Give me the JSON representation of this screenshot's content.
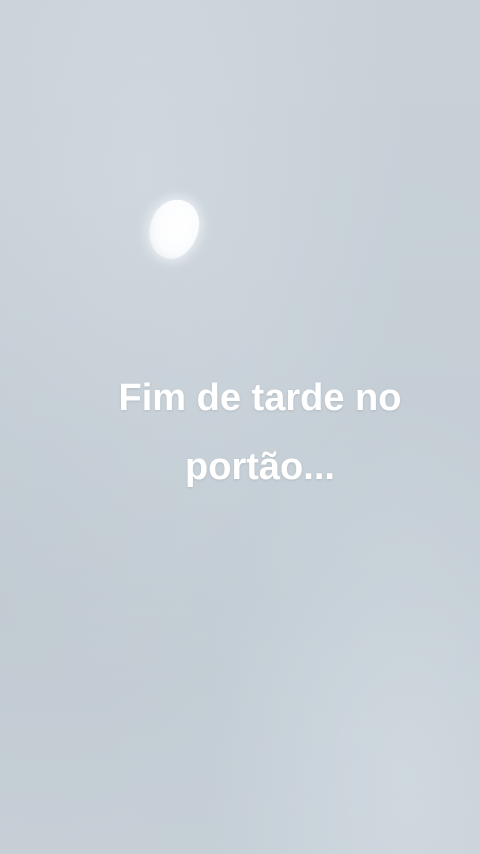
{
  "caption": {
    "line1": "Fim de tarde no",
    "line2": "portão..."
  },
  "colors": {
    "sky": "#c6cfd6",
    "moon": "#ffffff",
    "caption_text": "#ffffff"
  }
}
